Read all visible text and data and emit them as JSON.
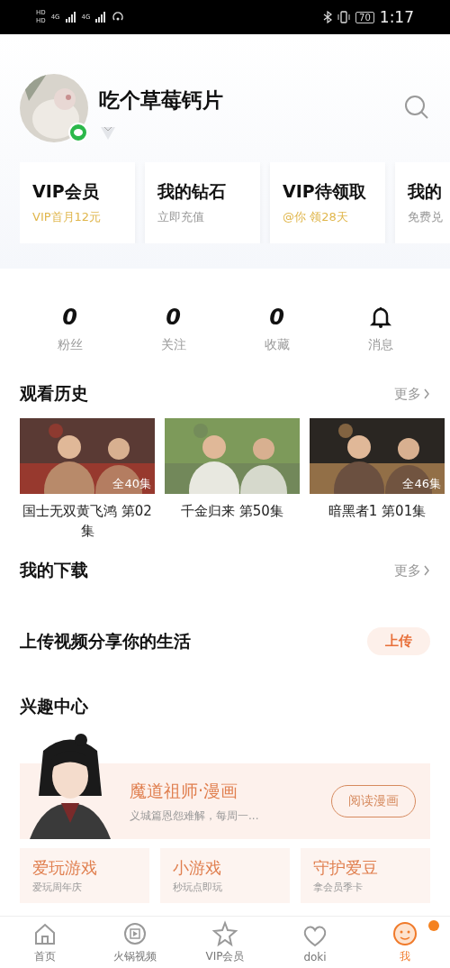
{
  "status_bar": {
    "hd": [
      "HD",
      "HD"
    ],
    "network": [
      "4G",
      "4G"
    ],
    "battery": "70",
    "time": "1:17"
  },
  "profile": {
    "name": "吃个草莓钙片",
    "online": true
  },
  "vip_cards": [
    {
      "title": "VIP会员",
      "subtitle": "VIP首月12元",
      "kind": "gold"
    },
    {
      "title": "我的钻石",
      "subtitle": "立即充值",
      "kind": "grey"
    },
    {
      "title": "VIP待领取",
      "subtitle": "@你 领28天",
      "kind": "gold"
    },
    {
      "title": "我的",
      "subtitle": "免费兑",
      "kind": "grey"
    }
  ],
  "stats": [
    {
      "kind": "count",
      "value": "0",
      "label": "粉丝"
    },
    {
      "kind": "count",
      "value": "0",
      "label": "关注"
    },
    {
      "kind": "count",
      "value": "0",
      "label": "收藏"
    },
    {
      "kind": "bell",
      "label": "消息"
    }
  ],
  "history": {
    "title": "观看历史",
    "more": "更多",
    "items": [
      {
        "badge": "全40集",
        "title": "国士无双黄飞鸿 第02集",
        "kind": "picture"
      },
      {
        "title": "千金归来 第50集",
        "kind": "picture"
      },
      {
        "badge": "全46集",
        "title": "暗黑者1 第01集",
        "kind": "picture"
      }
    ]
  },
  "downloads": {
    "title": "我的下载",
    "more": "更多"
  },
  "upload": {
    "title": "上传视频分享你的生活",
    "button": "上传"
  },
  "interest": {
    "title": "兴趣中心",
    "banner": {
      "title": "魔道祖师·漫画",
      "subtitle": "义城篇恩怨难解，每周一...",
      "button": "阅读漫画"
    },
    "cards": [
      {
        "title": "爱玩游戏",
        "subtitle": "爱玩周年庆"
      },
      {
        "title": "小游戏",
        "subtitle": "秒玩点即玩"
      },
      {
        "title": "守护爱豆",
        "subtitle": "拿会员季卡"
      }
    ]
  },
  "tab_bar": [
    {
      "label": "首页",
      "kind": "home",
      "selected": false
    },
    {
      "label": "火锅视频",
      "kind": "video",
      "selected": false
    },
    {
      "label": "VIP会员",
      "kind": "vip",
      "selected": false
    },
    {
      "label": "doki",
      "kind": "doki",
      "selected": false
    },
    {
      "label": "我",
      "kind": "me",
      "selected": true,
      "badge": true
    }
  ]
}
